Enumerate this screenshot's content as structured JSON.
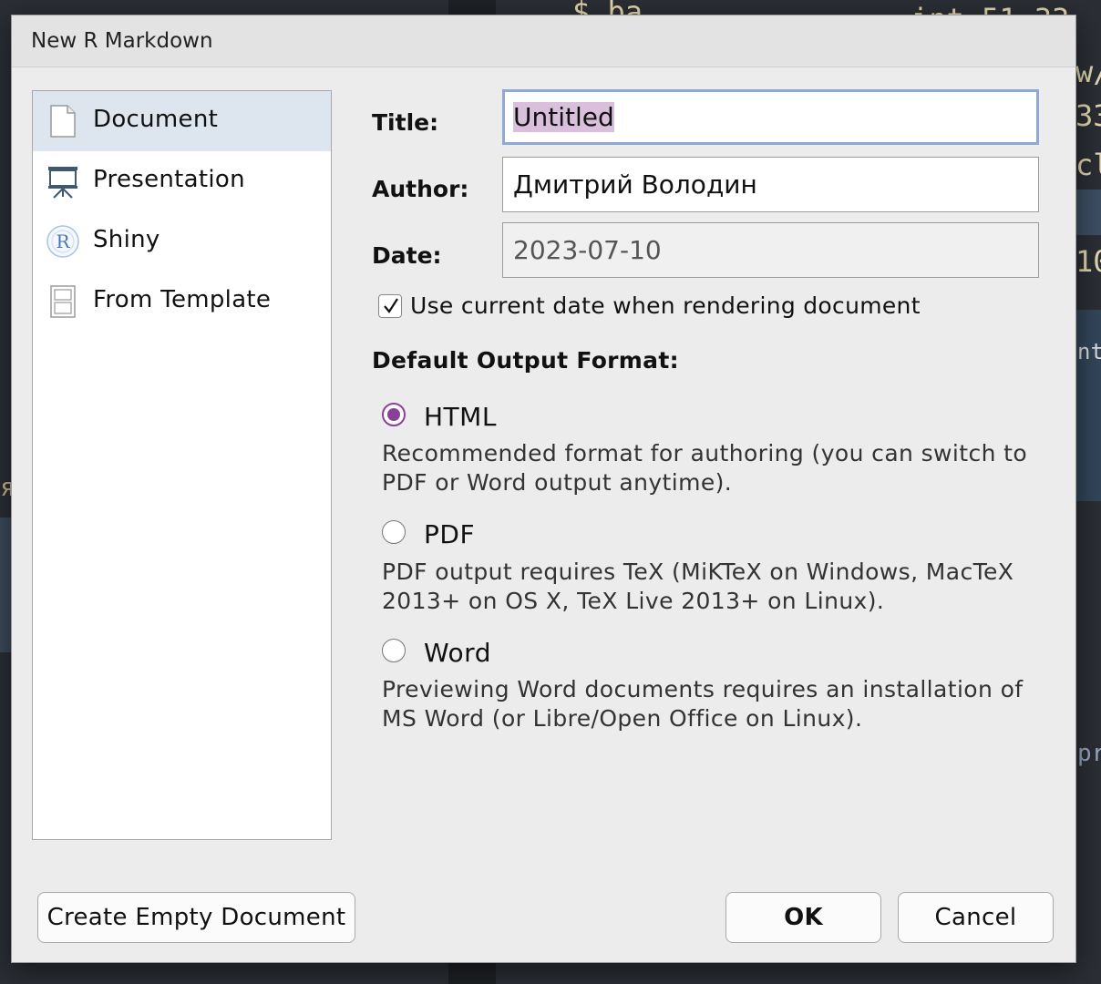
{
  "background": {
    "code_fragments": [
      "$ ba",
      "int 51 33",
      "w/",
      "33",
      "cl",
      "10",
      "nta",
      "я",
      "pr"
    ]
  },
  "dialog": {
    "title": "New R Markdown"
  },
  "sidebar": {
    "items": [
      {
        "label": "Document",
        "icon": "document-icon",
        "selected": true
      },
      {
        "label": "Presentation",
        "icon": "presentation-icon",
        "selected": false
      },
      {
        "label": "Shiny",
        "icon": "shiny-r-icon",
        "selected": false
      },
      {
        "label": "From Template",
        "icon": "template-icon",
        "selected": false
      }
    ]
  },
  "form": {
    "title_label": "Title:",
    "title_value": "Untitled",
    "author_label": "Author:",
    "author_value": "Дмитрий Володин",
    "date_label": "Date:",
    "date_value": "2023-07-10",
    "use_current_date_label": "Use current date when rendering document",
    "use_current_date_checked": true
  },
  "output_format": {
    "heading": "Default Output Format:",
    "options": [
      {
        "label": "HTML",
        "selected": true,
        "desc_line1": "Recommended format for authoring (you can switch to",
        "desc_line2": "PDF or Word output anytime)."
      },
      {
        "label": "PDF",
        "selected": false,
        "desc_line1": "PDF output requires TeX (MiKTeX on Windows, MacTeX",
        "desc_line2": "2013+ on OS X, TeX Live 2013+ on Linux)."
      },
      {
        "label": "Word",
        "selected": false,
        "desc_line1": "Previewing Word documents requires an installation of",
        "desc_line2": "MS Word (or Libre/Open Office on Linux)."
      }
    ]
  },
  "buttons": {
    "create_empty": "Create Empty Document",
    "ok": "OK",
    "cancel": "Cancel"
  },
  "colors": {
    "accent_radio": "#8a3f99",
    "focus_border": "#8ea9d6",
    "selection_highlight": "#d9bfdc",
    "sidebar_selected": "#dde6ef"
  }
}
